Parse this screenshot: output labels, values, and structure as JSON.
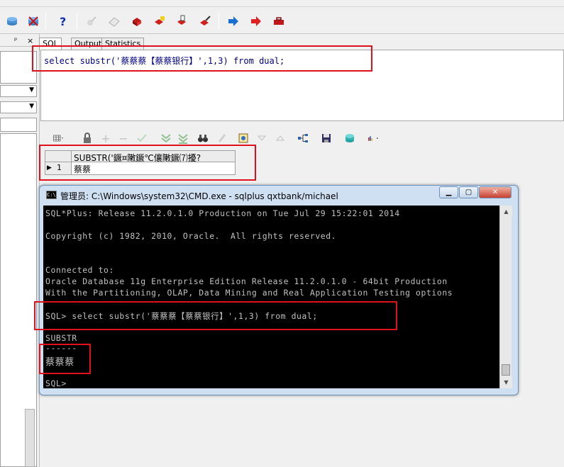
{
  "tabs": [
    {
      "label": "SQL"
    },
    {
      "label": "Output"
    },
    {
      "label": "Statistics"
    }
  ],
  "left_panel": {
    "pin": "ᵖ",
    "close": "×"
  },
  "editor": {
    "sql_text": "select substr('蔡蔡蔡【蔡蔡银行】',1,3) from dual;"
  },
  "grid": {
    "column_header": "SUBSTR('鐝¤敶鐝℃儴敶鐝⑺擾?",
    "row_number": "1",
    "row_value": "蔡蔡"
  },
  "cmd_window": {
    "title": "管理员: C:\\Windows\\system32\\CMD.exe - sqlplus  qxtbank/michael",
    "lines": [
      "SQL*Plus: Release 11.2.0.1.0 Production on Tue Jul 29 15:22:01 2014",
      "Copyright (c) 1982, 2010, Oracle.  All rights reserved.",
      "Connected to:",
      "Oracle Database 11g Enterprise Edition Release 11.2.0.1.0 - 64bit Production",
      "With the Partitioning, OLAP, Data Mining and Real Application Testing options",
      "SQL> select substr('蔡蔡蔡【蔡蔡银行】',1,3) from dual;",
      "SUBSTR",
      "------",
      "蔡蔡蔡",
      "SQL>"
    ]
  },
  "colors": {
    "highlight_box": "#e0101c",
    "sql_text": "#000080",
    "console_bg": "#000000",
    "console_text": "#c0c0c0"
  }
}
